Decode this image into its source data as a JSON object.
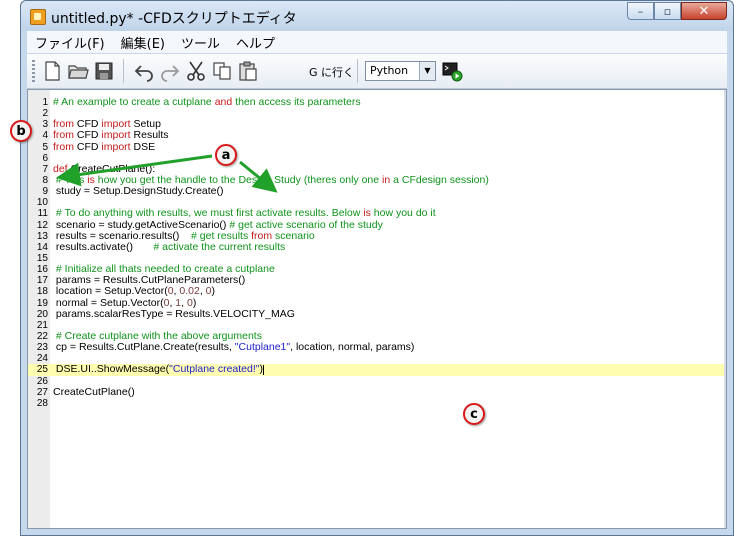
{
  "window": {
    "title": "untitled.py* -CFDスクリプトエディタ"
  },
  "window_controls": {
    "minimize": "–",
    "maximize": "▫",
    "close": "✕"
  },
  "menu": [
    "ファイル(F)",
    "編集(E)",
    "ツール",
    "ヘルプ"
  ],
  "toolbar": {
    "goto_label": "G に行く",
    "language": "Python"
  },
  "callouts": {
    "a": "a",
    "b": "b",
    "c": "c"
  },
  "colors": {
    "comment": "#10931c",
    "keyword": "#c41a1a",
    "string": "#1c1ccf",
    "highlight": "#fffeb0"
  },
  "code_lines": [
    {
      "n": "1",
      "parts": [
        {
          "t": "c",
          "v": "# An example to create a cutplane "
        },
        {
          "t": "k",
          "v": "and"
        },
        {
          "t": "c",
          "v": " then access its parameters"
        }
      ]
    },
    {
      "n": "2",
      "parts": []
    },
    {
      "n": "3",
      "parts": [
        {
          "t": "k",
          "v": "from"
        },
        {
          "t": "p",
          "v": " CFD "
        },
        {
          "t": "k",
          "v": "import"
        },
        {
          "t": "p",
          "v": " Setup"
        }
      ]
    },
    {
      "n": "4",
      "parts": [
        {
          "t": "k",
          "v": "from"
        },
        {
          "t": "p",
          "v": " CFD "
        },
        {
          "t": "k",
          "v": "import"
        },
        {
          "t": "p",
          "v": " Results"
        }
      ]
    },
    {
      "n": "5",
      "parts": [
        {
          "t": "k",
          "v": "from"
        },
        {
          "t": "p",
          "v": " CFD "
        },
        {
          "t": "k",
          "v": "import"
        },
        {
          "t": "p",
          "v": " DSE"
        }
      ]
    },
    {
      "n": "6",
      "parts": []
    },
    {
      "n": "7",
      "parts": [
        {
          "t": "k",
          "v": "def"
        },
        {
          "t": "p",
          "v": " CreateCutPlane():"
        }
      ]
    },
    {
      "n": "8",
      "parts": [
        {
          "t": "c",
          "v": " # This "
        },
        {
          "t": "k",
          "v": "is"
        },
        {
          "t": "c",
          "v": " how you get the handle to the Design Study (theres only one "
        },
        {
          "t": "k",
          "v": "in"
        },
        {
          "t": "c",
          "v": " a CFdesign session)"
        }
      ]
    },
    {
      "n": "9",
      "parts": [
        {
          "t": "p",
          "v": " study = Setup.DesignStudy.Create()"
        }
      ]
    },
    {
      "n": "10",
      "parts": []
    },
    {
      "n": "11",
      "parts": [
        {
          "t": "c",
          "v": " # To do anything with results, we must first activate results. Below "
        },
        {
          "t": "k",
          "v": "is"
        },
        {
          "t": "c",
          "v": " how you do it"
        }
      ]
    },
    {
      "n": "12",
      "parts": [
        {
          "t": "p",
          "v": " scenario = study.getActiveScenario() "
        },
        {
          "t": "c",
          "v": "# get active scenario of the study"
        }
      ]
    },
    {
      "n": "13",
      "parts": [
        {
          "t": "p",
          "v": " results = scenario.results()    "
        },
        {
          "t": "c",
          "v": "# get results "
        },
        {
          "t": "k",
          "v": "from"
        },
        {
          "t": "c",
          "v": " scenario"
        }
      ]
    },
    {
      "n": "14",
      "parts": [
        {
          "t": "p",
          "v": " results.activate()       "
        },
        {
          "t": "c",
          "v": "# activate the current results"
        }
      ]
    },
    {
      "n": "15",
      "parts": []
    },
    {
      "n": "16",
      "parts": [
        {
          "t": "c",
          "v": " # Initialize all thats needed to create a cutplane"
        }
      ]
    },
    {
      "n": "17",
      "parts": [
        {
          "t": "p",
          "v": " params = Results.CutPlaneParameters()"
        }
      ]
    },
    {
      "n": "18",
      "parts": [
        {
          "t": "p",
          "v": " location = Setup.Vector("
        },
        {
          "t": "n",
          "v": "0"
        },
        {
          "t": "p",
          "v": ", "
        },
        {
          "t": "n",
          "v": "0.02"
        },
        {
          "t": "p",
          "v": ", "
        },
        {
          "t": "n",
          "v": "0"
        },
        {
          "t": "p",
          "v": ")"
        }
      ]
    },
    {
      "n": "19",
      "parts": [
        {
          "t": "p",
          "v": " normal = Setup.Vector("
        },
        {
          "t": "n",
          "v": "0"
        },
        {
          "t": "p",
          "v": ", "
        },
        {
          "t": "n",
          "v": "1"
        },
        {
          "t": "p",
          "v": ", "
        },
        {
          "t": "n",
          "v": "0"
        },
        {
          "t": "p",
          "v": ")"
        }
      ]
    },
    {
      "n": "20",
      "parts": [
        {
          "t": "p",
          "v": " params.scalarResType = Results.VELOCITY_MAG"
        }
      ]
    },
    {
      "n": "21",
      "parts": []
    },
    {
      "n": "22",
      "parts": [
        {
          "t": "c",
          "v": " # Create cutplane with the above arguments"
        }
      ]
    },
    {
      "n": "23",
      "parts": [
        {
          "t": "p",
          "v": " cp = Results.CutPlane.Create(results, "
        },
        {
          "t": "s",
          "v": "\"Cutplane1\""
        },
        {
          "t": "p",
          "v": ", location, normal, params)"
        }
      ]
    },
    {
      "n": "24",
      "parts": []
    },
    {
      "n": "25",
      "highlight": true,
      "cursor": true,
      "parts": [
        {
          "t": "p",
          "v": " DSE.UI..ShowMessage("
        },
        {
          "t": "s",
          "v": "\"Cutplane created!\""
        },
        {
          "t": "p",
          "v": ")"
        }
      ]
    },
    {
      "n": "26",
      "parts": []
    },
    {
      "n": "27",
      "parts": [
        {
          "t": "p",
          "v": "CreateCutPlane()"
        }
      ]
    },
    {
      "n": "28",
      "parts": []
    }
  ]
}
